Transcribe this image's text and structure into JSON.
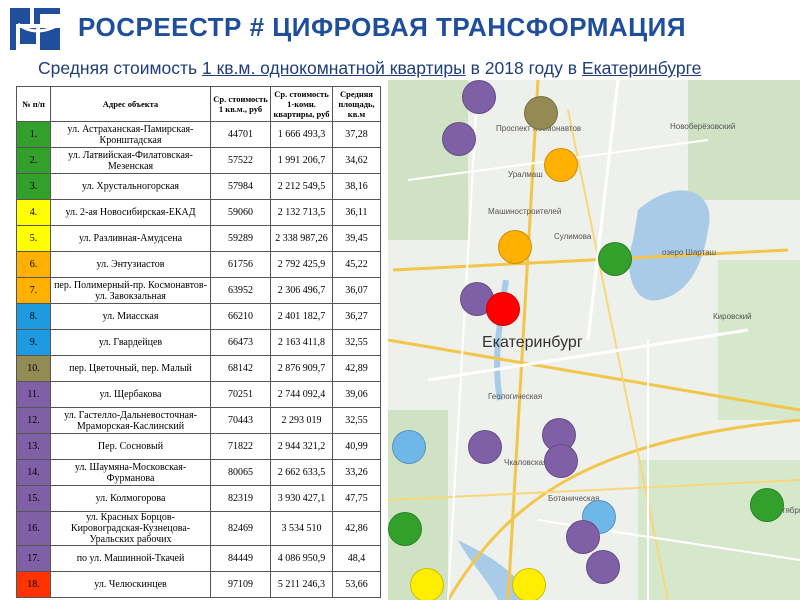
{
  "header": {
    "title": "РОСРЕЕСТР # ЦИФРОВАЯ ТРАНСФОРМАЦИЯ",
    "subtitle_pre": "Средняя стоимость ",
    "subtitle_u1": "1 кв.м. однокомнатной квартиры",
    "subtitle_mid": " в 2018 году в ",
    "subtitle_u2": "Екатеринбурге"
  },
  "table": {
    "headers": [
      "№ п/п",
      "Адрес объекта",
      "Ср. стоимость 1 кв.м., руб",
      "Ср. стоимость 1-комн. квартиры, руб",
      "Средняя площадь, кв.м"
    ],
    "rows": [
      {
        "n": "1.",
        "addr": "ул. Астраханская-Памирская-Кронштадская",
        "ppm": "44701",
        "price": "1 666 493,3",
        "area": "37,28",
        "color": "#33a02c"
      },
      {
        "n": "2.",
        "addr": "ул. Латвийская-Филатовская-Мезенская",
        "ppm": "57522",
        "price": "1 991 206,7",
        "area": "34,62",
        "color": "#33a02c"
      },
      {
        "n": "3.",
        "addr": "ул. Хрустальногорская",
        "ppm": "57984",
        "price": "2 212 549,5",
        "area": "38,16",
        "color": "#33a02c"
      },
      {
        "n": "4.",
        "addr": "ул. 2-ая Новосибирская-ЕКАД",
        "ppm": "59060",
        "price": "2 132 713,5",
        "area": "36,11",
        "color": "#ffff00"
      },
      {
        "n": "5.",
        "addr": "ул. Разливная-Амудсена",
        "ppm": "59289",
        "price": "2 338 987,26",
        "area": "39,45",
        "color": "#ffff00"
      },
      {
        "n": "6.",
        "addr": "ул. Энтузиастов",
        "ppm": "61756",
        "price": "2 792 425,9",
        "area": "45,22",
        "color": "#ffb000"
      },
      {
        "n": "7.",
        "addr": "пер. Полимерный-пр. Космонавтов-ул. Завокзальная",
        "ppm": "63952",
        "price": "2 306 496,7",
        "area": "36,07",
        "color": "#ffb000"
      },
      {
        "n": "8.",
        "addr": "ул. Миасская",
        "ppm": "66210",
        "price": "2 401 182,7",
        "area": "36,27",
        "color": "#1e9be0"
      },
      {
        "n": "9.",
        "addr": "ул. Гвардейцев",
        "ppm": "66473",
        "price": "2 163 411,8",
        "area": "32,55",
        "color": "#1e9be0"
      },
      {
        "n": "10.",
        "addr": "пер. Цветочный, пер. Малый",
        "ppm": "68142",
        "price": "2 876 909,7",
        "area": "42,89",
        "color": "#948a54"
      },
      {
        "n": "11.",
        "addr": "ул. Щербакова",
        "ppm": "70251",
        "price": "2 744 092,4",
        "area": "39,06",
        "color": "#7f5fa6"
      },
      {
        "n": "12.",
        "addr": "ул. Гастелло-Дальневосточная-Мраморская-Каслинский",
        "ppm": "70443",
        "price": "2 293 019",
        "area": "32,55",
        "color": "#7f5fa6"
      },
      {
        "n": "13.",
        "addr": "Пер. Сосновый",
        "ppm": "71822",
        "price": "2 944 321,2",
        "area": "40,99",
        "color": "#7f5fa6"
      },
      {
        "n": "14.",
        "addr": "ул. Шаумяна-Московская-Фурманова",
        "ppm": "80065",
        "price": "2 662 633,5",
        "area": "33,26",
        "color": "#7f5fa6"
      },
      {
        "n": "15.",
        "addr": "ул. Колмогорова",
        "ppm": "82319",
        "price": "3 930 427,1",
        "area": "47,75",
        "color": "#7f5fa6"
      },
      {
        "n": "16.",
        "addr": "ул. Красных Борцов-Кировоградская-Кузнецова-Уральских рабочих",
        "ppm": "82469",
        "price": "3 534 510",
        "area": "42,86",
        "color": "#7f5fa6"
      },
      {
        "n": "17.",
        "addr": "по ул. Машинной-Ткачей",
        "ppm": "84449",
        "price": "4 086 950,9",
        "area": "48,4",
        "color": "#7f5fa6"
      },
      {
        "n": "18.",
        "addr": "ул. Челюскинцев",
        "ppm": "97109",
        "price": "5 211 246,3",
        "area": "53,66",
        "color": "#ff3300"
      }
    ]
  },
  "map": {
    "city_label": "Екатеринбург",
    "labels": [
      "Проспект Космонавтов",
      "Новоберёзовский",
      "Уралмаш",
      "Машиностроителей",
      "Сулимова",
      "Кировский",
      "озеро Шарташ",
      "Геологическая",
      "Чкаловская",
      "Ботаническая",
      "Октябрь"
    ],
    "markers": [
      {
        "color": "#7f5fa6"
      },
      {
        "color": "#948a54"
      },
      {
        "color": "#7f5fa6"
      },
      {
        "color": "#ffb000"
      },
      {
        "color": "#ffb000"
      },
      {
        "color": "#33a02c"
      },
      {
        "color": "#7f5fa6"
      },
      {
        "color": "#ff0000"
      },
      {
        "color": "#7f5fa6"
      },
      {
        "color": "#7f5fa6"
      },
      {
        "color": "#6fb7e8"
      },
      {
        "color": "#7f5fa6"
      },
      {
        "color": "#33a02c"
      },
      {
        "color": "#33a02c"
      },
      {
        "color": "#6fb7e8"
      },
      {
        "color": "#7f5fa6"
      },
      {
        "color": "#7f5fa6"
      },
      {
        "color": "#ffee00"
      },
      {
        "color": "#ffee00"
      }
    ]
  }
}
